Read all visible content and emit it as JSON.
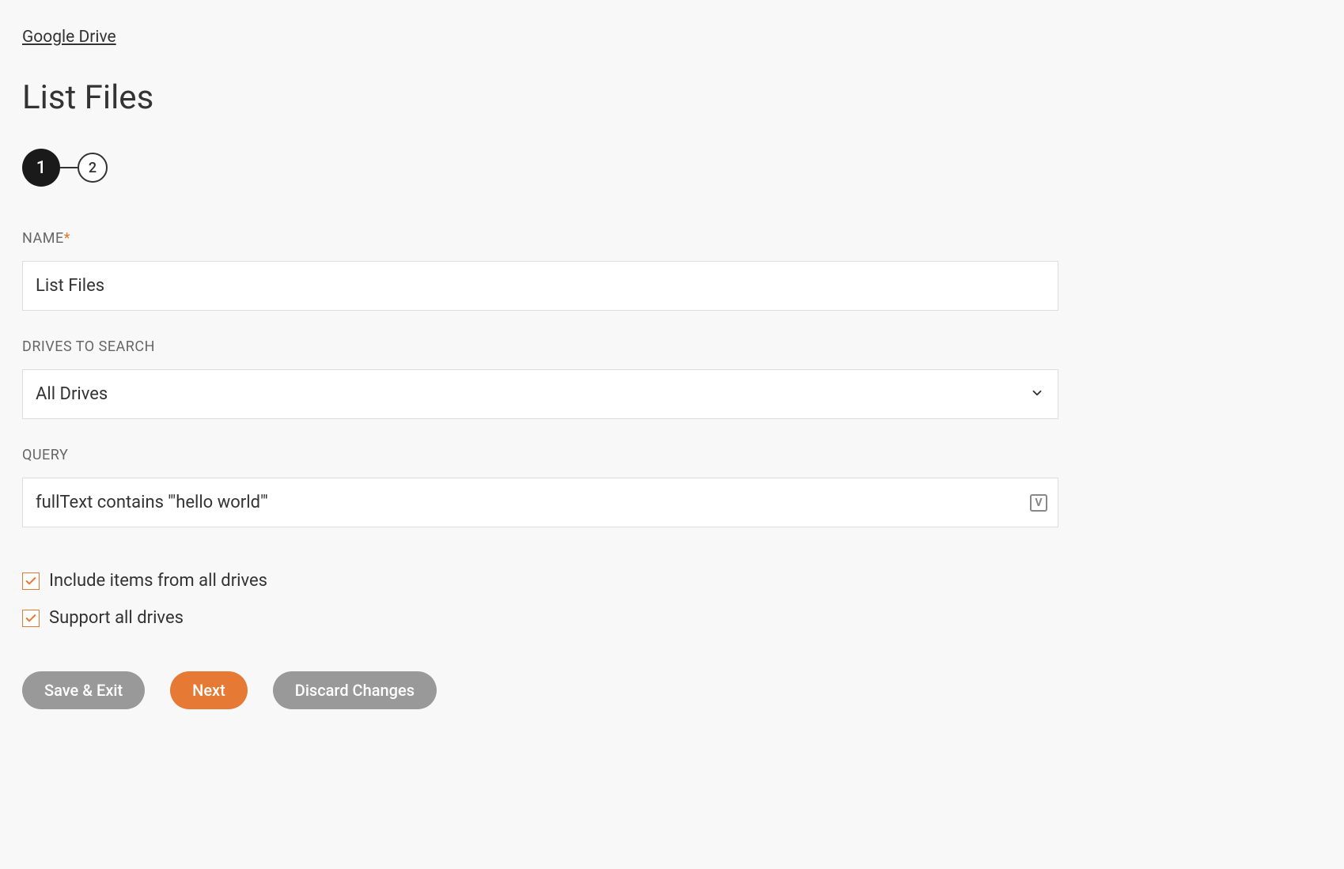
{
  "breadcrumb": {
    "label": "Google Drive"
  },
  "page_title": "List Files",
  "stepper": {
    "steps": [
      "1",
      "2"
    ],
    "active_index": 0
  },
  "form": {
    "name": {
      "label": "NAME",
      "required": true,
      "value": "List Files"
    },
    "drives": {
      "label": "DRIVES TO SEARCH",
      "value": "All Drives"
    },
    "query": {
      "label": "QUERY",
      "value": "fullText contains '\"hello world\"'"
    },
    "checkboxes": {
      "include_all_drives": {
        "label": "Include items from all drives",
        "checked": true
      },
      "support_all_drives": {
        "label": "Support all drives",
        "checked": true
      }
    }
  },
  "buttons": {
    "save_exit": "Save & Exit",
    "next": "Next",
    "discard": "Discard Changes"
  },
  "required_marker": "*"
}
